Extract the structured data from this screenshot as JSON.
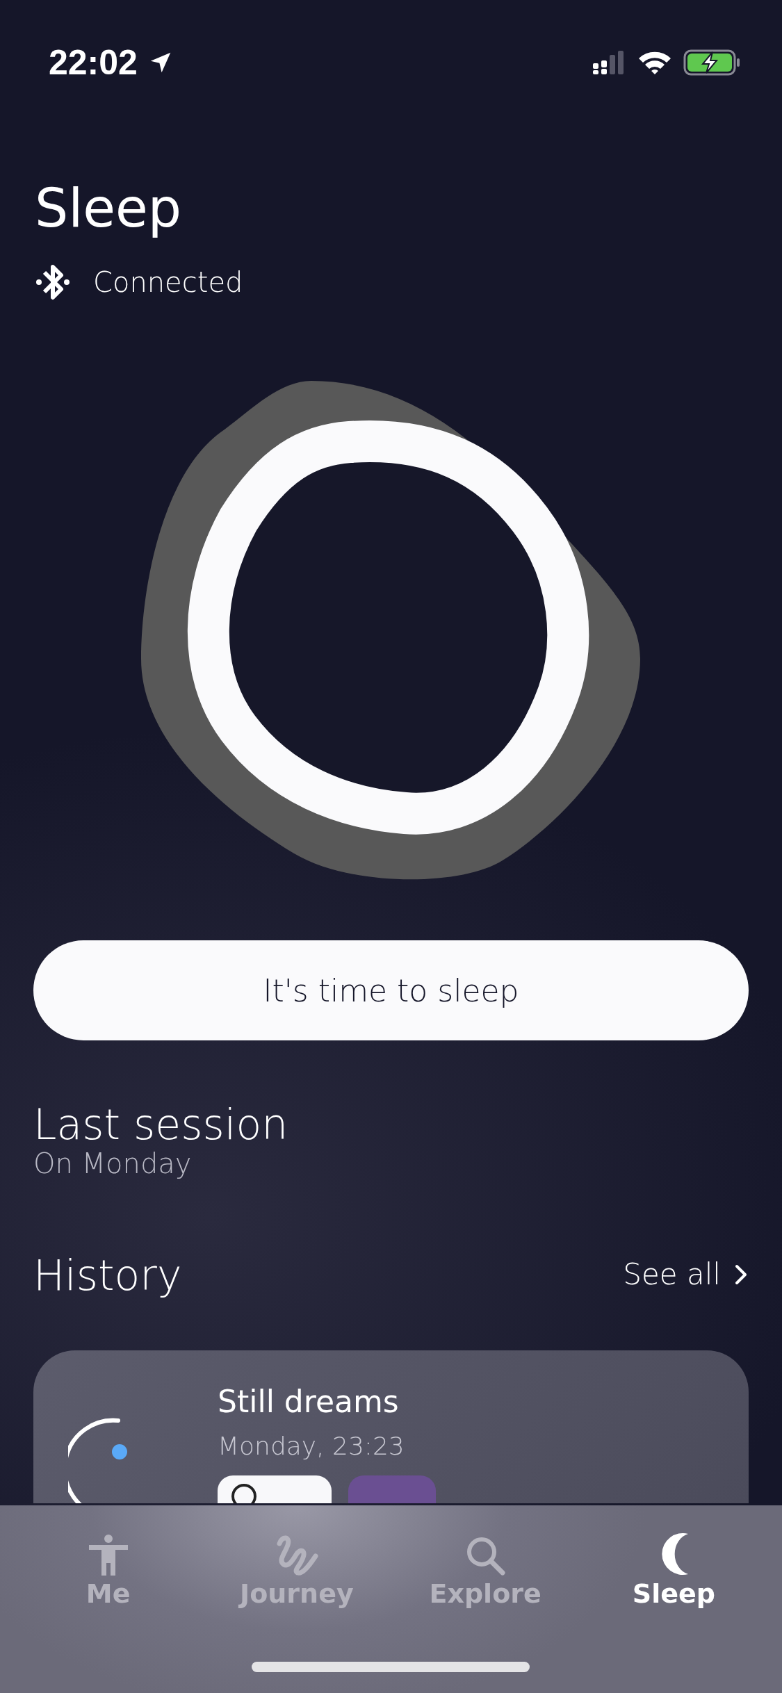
{
  "status_bar": {
    "time": "22:02"
  },
  "header": {
    "title": "Sleep",
    "connection": "Connected"
  },
  "action_button": {
    "label": "It's time to sleep"
  },
  "last_session": {
    "title": "Last session",
    "subtitle": "On Monday"
  },
  "history": {
    "title": "History",
    "link": "See all",
    "items": [
      {
        "title": "Still dreams",
        "date": "Monday, 23:23",
        "chips": [
          {
            "kind": "duration",
            "color": "#f8f8fa"
          },
          {
            "kind": "stage",
            "color": "#6a4f92"
          }
        ]
      }
    ]
  },
  "tab_bar": [
    {
      "label": "Me",
      "kind": "figure",
      "selected": false
    },
    {
      "label": "Journey",
      "kind": "squiggle",
      "selected": false
    },
    {
      "label": "Explore",
      "kind": "search",
      "selected": false
    },
    {
      "label": "Sleep",
      "kind": "moon",
      "selected": true
    }
  ]
}
